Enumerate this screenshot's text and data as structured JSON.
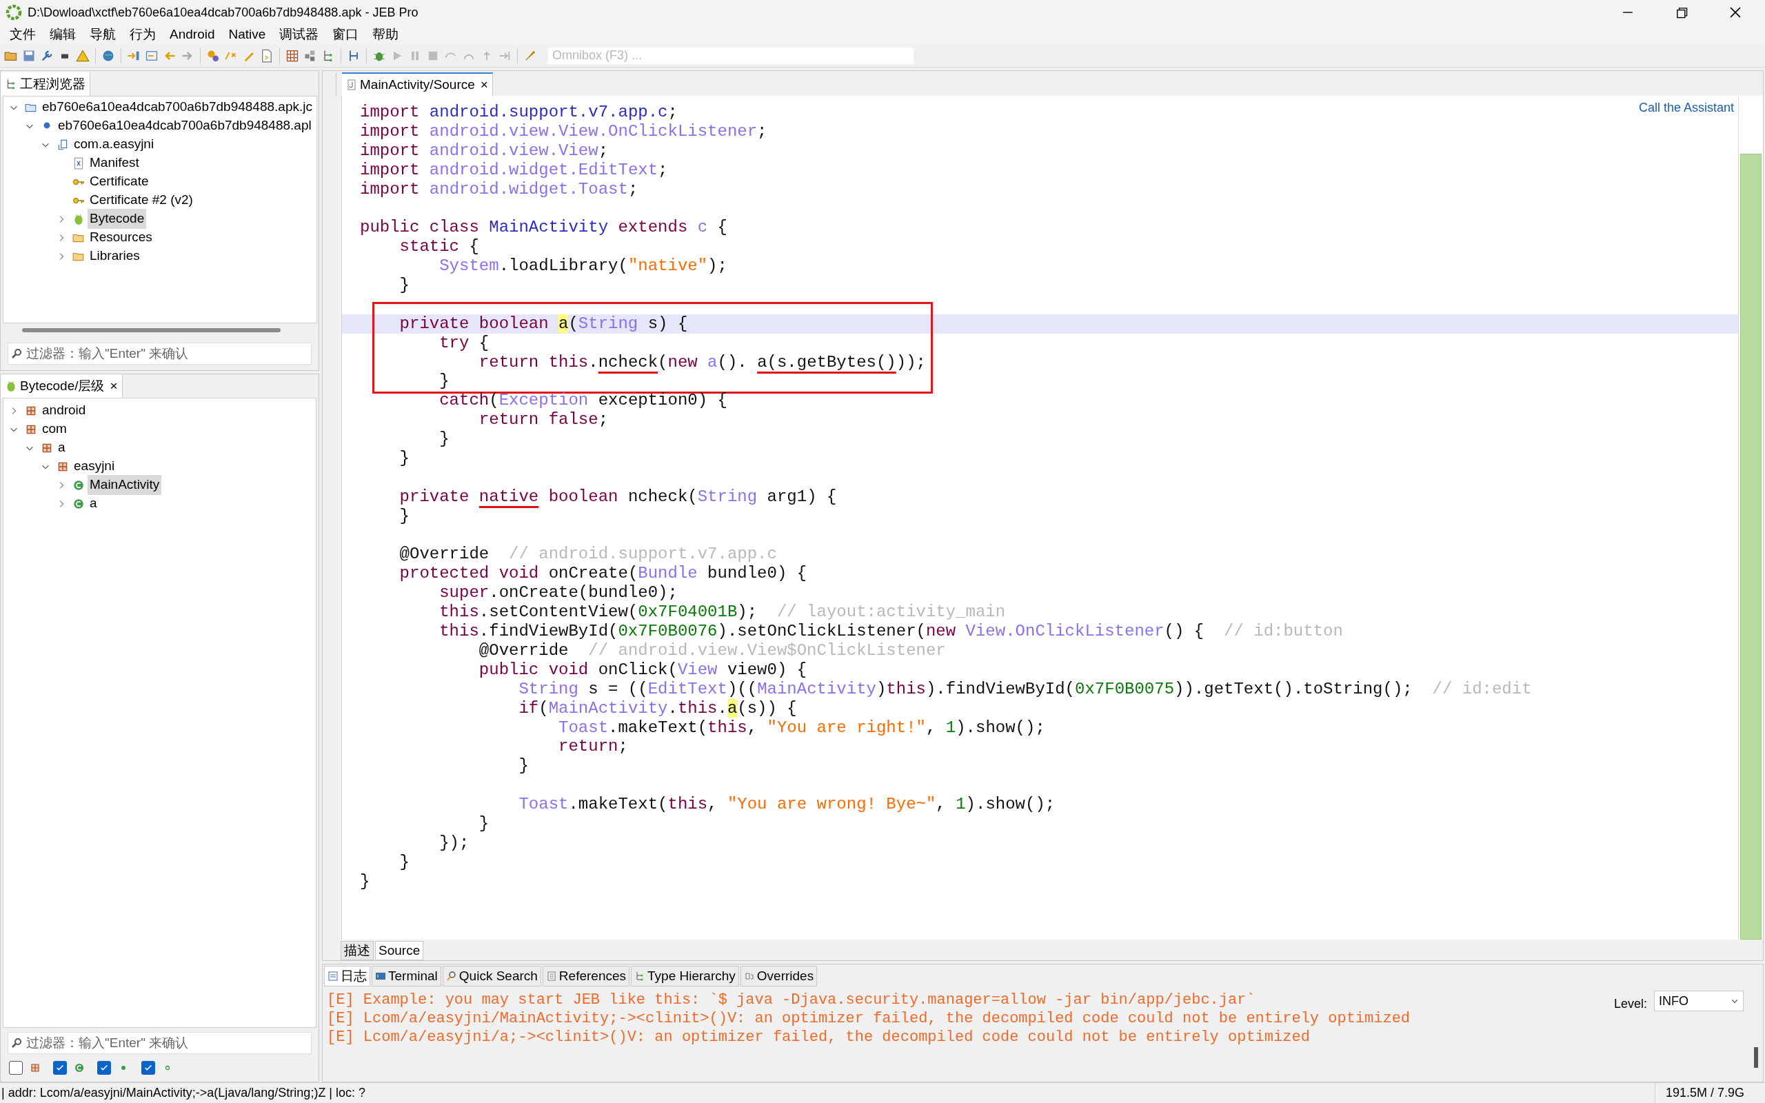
{
  "window": {
    "title": "D:\\Dowload\\xctf\\eb760e6a10ea4dcab700a6b7db948488.apk - JEB Pro"
  },
  "menu": [
    "文件",
    "编辑",
    "导航",
    "行为",
    "Android",
    "Native",
    "调试器",
    "窗口",
    "帮助"
  ],
  "toolbar": {
    "omnibox_placeholder": "Omnibox (F3) ..."
  },
  "project_explorer": {
    "tab": "工程浏览器",
    "filter_placeholder": "过滤器：输入\"Enter\" 来确认",
    "tree": [
      {
        "kind": "project",
        "label": "eb760e6a10ea4dcab700a6b7db948488.apk.jc",
        "expanded": true,
        "selected": false,
        "children": [
          {
            "kind": "apk",
            "label": "eb760e6a10ea4dcab700a6b7db948488.apl",
            "expanded": true,
            "selected": false,
            "children": [
              {
                "kind": "app",
                "label": "com.a.easyjni",
                "expanded": true,
                "selected": false,
                "children": [
                  {
                    "kind": "manifest",
                    "label": "Manifest",
                    "selected": false
                  },
                  {
                    "kind": "certificate",
                    "label": "Certificate",
                    "selected": false
                  },
                  {
                    "kind": "certificate",
                    "label": "Certificate #2 (v2)",
                    "selected": false
                  },
                  {
                    "kind": "bytecode",
                    "label": "Bytecode",
                    "expanded": false,
                    "selected": true
                  },
                  {
                    "kind": "folder",
                    "label": "Resources",
                    "expanded": false,
                    "selected": false
                  },
                  {
                    "kind": "folder",
                    "label": "Libraries",
                    "expanded": false,
                    "selected": false
                  }
                ]
              }
            ]
          }
        ]
      }
    ]
  },
  "hierarchy": {
    "tab": "Bytecode/层级",
    "close": "×",
    "filter_placeholder": "过滤器：输入\"Enter\" 来确认",
    "tree": [
      {
        "kind": "package",
        "label": "android",
        "expanded": false,
        "selected": false
      },
      {
        "kind": "package",
        "label": "com",
        "expanded": true,
        "selected": false,
        "children": [
          {
            "kind": "package",
            "label": "a",
            "expanded": true,
            "selected": false,
            "children": [
              {
                "kind": "package",
                "label": "easyjni",
                "expanded": true,
                "selected": false,
                "children": [
                  {
                    "kind": "class",
                    "label": "MainActivity",
                    "expanded": false,
                    "selected": true
                  },
                  {
                    "kind": "class",
                    "label": "a",
                    "expanded": false,
                    "selected": false
                  }
                ]
              }
            ]
          }
        ]
      }
    ],
    "filters": [
      {
        "kind": "package",
        "checked": false
      },
      {
        "kind": "class",
        "checked": true
      },
      {
        "kind": "method",
        "checked": true
      },
      {
        "kind": "field",
        "checked": true
      }
    ]
  },
  "editor": {
    "tab": "MainActivity/Source",
    "close": "×",
    "assistant_link": "Call the Assistant",
    "blocks": [
      {
        "boxed": false,
        "lines": [
          {
            "current": false,
            "segments": [
              {
                "kind": "kw",
                "text": "import "
              },
              {
                "kind": "pkg",
                "text": "android.support.v7.app.c"
              },
              {
                "kind": "plain",
                "text": ";"
              }
            ]
          },
          {
            "current": false,
            "segments": [
              {
                "kind": "kw",
                "text": "import "
              },
              {
                "kind": "type",
                "text": "android.view.View.OnClickListener"
              },
              {
                "kind": "plain",
                "text": ";"
              }
            ]
          },
          {
            "current": false,
            "segments": [
              {
                "kind": "kw",
                "text": "import "
              },
              {
                "kind": "type",
                "text": "android.view.View"
              },
              {
                "kind": "plain",
                "text": ";"
              }
            ]
          },
          {
            "current": false,
            "segments": [
              {
                "kind": "kw",
                "text": "import "
              },
              {
                "kind": "type",
                "text": "android.widget.EditText"
              },
              {
                "kind": "plain",
                "text": ";"
              }
            ]
          },
          {
            "current": false,
            "segments": [
              {
                "kind": "kw",
                "text": "import "
              },
              {
                "kind": "type",
                "text": "android.widget.Toast"
              },
              {
                "kind": "plain",
                "text": ";"
              }
            ]
          },
          {
            "current": false
          },
          {
            "current": false,
            "segments": [
              {
                "kind": "kw",
                "text": "public class "
              },
              {
                "kind": "pkg",
                "text": "MainActivity"
              },
              {
                "kind": "kw",
                "text": " extends "
              },
              {
                "kind": "type",
                "text": "c"
              },
              {
                "kind": "plain",
                "text": " {"
              }
            ]
          },
          {
            "current": false,
            "segments": [
              {
                "kind": "kw",
                "text": "    static "
              },
              {
                "kind": "plain",
                "text": "{"
              }
            ]
          },
          {
            "current": false,
            "segments": [
              {
                "kind": "type",
                "text": "        System"
              },
              {
                "kind": "plain",
                "text": ".loadLibrary("
              },
              {
                "kind": "str",
                "text": "\"native\""
              },
              {
                "kind": "plain",
                "text": ");"
              }
            ]
          },
          {
            "current": false,
            "segments": [
              {
                "kind": "plain",
                "text": "    }"
              }
            ]
          },
          {
            "current": false
          }
        ]
      },
      {
        "boxed": true,
        "lines": [
          {
            "current": true,
            "segments": [
              {
                "kind": "kw",
                "text": "    private boolean "
              },
              {
                "kind": "plain",
                "text": "a",
                "highlighted": true
              },
              {
                "kind": "plain",
                "text": "("
              },
              {
                "kind": "type",
                "text": "String"
              },
              {
                "kind": "plain",
                "text": " s) {"
              }
            ]
          },
          {
            "current": false,
            "segments": [
              {
                "kind": "kw",
                "text": "        try "
              },
              {
                "kind": "plain",
                "text": "{"
              }
            ]
          },
          {
            "current": false,
            "segments": [
              {
                "kind": "kw",
                "text": "            return this"
              },
              {
                "kind": "plain",
                "text": "."
              },
              {
                "kind": "plain",
                "text": "ncheck",
                "underlined": true
              },
              {
                "kind": "plain",
                "text": "("
              },
              {
                "kind": "kw",
                "text": "new "
              },
              {
                "kind": "type",
                "text": "a"
              },
              {
                "kind": "plain",
                "text": "(). "
              },
              {
                "kind": "plain",
                "text": "a(s.getBytes()",
                "underlined": true
              },
              {
                "kind": "plain",
                "text": "));"
              }
            ]
          },
          {
            "current": false,
            "segments": [
              {
                "kind": "plain",
                "text": "        }"
              }
            ]
          }
        ]
      },
      {
        "boxed": false,
        "lines": [
          {
            "current": false,
            "segments": [
              {
                "kind": "kw",
                "text": "        catch"
              },
              {
                "kind": "plain",
                "text": "("
              },
              {
                "kind": "type",
                "text": "Exception"
              },
              {
                "kind": "plain",
                "text": " exception0) {"
              }
            ]
          },
          {
            "current": false,
            "segments": [
              {
                "kind": "kw",
                "text": "            return false"
              },
              {
                "kind": "plain",
                "text": ";"
              }
            ]
          },
          {
            "current": false,
            "segments": [
              {
                "kind": "plain",
                "text": "        }"
              }
            ]
          },
          {
            "current": false,
            "segments": [
              {
                "kind": "plain",
                "text": "    }"
              }
            ]
          },
          {
            "current": false
          },
          {
            "current": false,
            "segments": [
              {
                "kind": "kw",
                "text": "    private "
              },
              {
                "kind": "kw",
                "text": "native",
                "underlined": true
              },
              {
                "kind": "kw",
                "text": " boolean "
              },
              {
                "kind": "plain",
                "text": "ncheck("
              },
              {
                "kind": "type",
                "text": "String"
              },
              {
                "kind": "plain",
                "text": " arg1) {"
              }
            ]
          },
          {
            "current": false,
            "segments": [
              {
                "kind": "plain",
                "text": "    }"
              }
            ]
          },
          {
            "current": false
          },
          {
            "current": false,
            "segments": [
              {
                "kind": "plain",
                "text": "    @Override  "
              },
              {
                "kind": "cmt",
                "text": "// android.support.v7.app.c"
              }
            ]
          },
          {
            "current": false,
            "segments": [
              {
                "kind": "kw",
                "text": "    protected void "
              },
              {
                "kind": "plain",
                "text": "onCreate("
              },
              {
                "kind": "type",
                "text": "Bundle"
              },
              {
                "kind": "plain",
                "text": " bundle0) {"
              }
            ]
          },
          {
            "current": false,
            "segments": [
              {
                "kind": "kw",
                "text": "        super"
              },
              {
                "kind": "plain",
                "text": ".onCreate(bundle0);"
              }
            ]
          },
          {
            "current": false,
            "segments": [
              {
                "kind": "kw",
                "text": "        this"
              },
              {
                "kind": "plain",
                "text": ".setContentView("
              },
              {
                "kind": "num",
                "text": "0x7F04001B"
              },
              {
                "kind": "plain",
                "text": ");  "
              },
              {
                "kind": "cmt",
                "text": "// layout:activity_main"
              }
            ]
          },
          {
            "current": false,
            "segments": [
              {
                "kind": "kw",
                "text": "        this"
              },
              {
                "kind": "plain",
                "text": ".findViewById("
              },
              {
                "kind": "num",
                "text": "0x7F0B0076"
              },
              {
                "kind": "plain",
                "text": ").setOnClickListener("
              },
              {
                "kind": "kw",
                "text": "new "
              },
              {
                "kind": "type",
                "text": "View.OnClickListener"
              },
              {
                "kind": "plain",
                "text": "() {  "
              },
              {
                "kind": "cmt",
                "text": "// id:button"
              }
            ]
          },
          {
            "current": false,
            "segments": [
              {
                "kind": "plain",
                "text": "            @Override  "
              },
              {
                "kind": "cmt",
                "text": "// android.view.View$OnClickListener"
              }
            ]
          },
          {
            "current": false,
            "segments": [
              {
                "kind": "kw",
                "text": "            public void "
              },
              {
                "kind": "plain",
                "text": "onClick("
              },
              {
                "kind": "type",
                "text": "View"
              },
              {
                "kind": "plain",
                "text": " view0) {"
              }
            ]
          },
          {
            "current": false,
            "segments": [
              {
                "kind": "type",
                "text": "                String"
              },
              {
                "kind": "plain",
                "text": " s = (("
              },
              {
                "kind": "type",
                "text": "EditText"
              },
              {
                "kind": "plain",
                "text": ")(("
              },
              {
                "kind": "type",
                "text": "MainActivity"
              },
              {
                "kind": "plain",
                "text": ")"
              },
              {
                "kind": "kw",
                "text": "this"
              },
              {
                "kind": "plain",
                "text": ").findViewById("
              },
              {
                "kind": "num",
                "text": "0x7F0B0075"
              },
              {
                "kind": "plain",
                "text": ")).getText().toString();  "
              },
              {
                "kind": "cmt",
                "text": "// id:edit"
              }
            ]
          },
          {
            "current": false,
            "segments": [
              {
                "kind": "kw",
                "text": "                if"
              },
              {
                "kind": "plain",
                "text": "("
              },
              {
                "kind": "type",
                "text": "MainActivity"
              },
              {
                "kind": "plain",
                "text": "."
              },
              {
                "kind": "kw",
                "text": "this"
              },
              {
                "kind": "plain",
                "text": "."
              },
              {
                "kind": "plain",
                "text": "a",
                "highlighted": true
              },
              {
                "kind": "plain",
                "text": "(s)) {"
              }
            ]
          },
          {
            "current": false,
            "segments": [
              {
                "kind": "type",
                "text": "                    Toast"
              },
              {
                "kind": "plain",
                "text": ".makeText("
              },
              {
                "kind": "kw",
                "text": "this"
              },
              {
                "kind": "plain",
                "text": ", "
              },
              {
                "kind": "str",
                "text": "\"You are right!\""
              },
              {
                "kind": "plain",
                "text": ", "
              },
              {
                "kind": "num",
                "text": "1"
              },
              {
                "kind": "plain",
                "text": ").show();"
              }
            ]
          },
          {
            "current": false,
            "segments": [
              {
                "kind": "kw",
                "text": "                    return"
              },
              {
                "kind": "plain",
                "text": ";"
              }
            ]
          },
          {
            "current": false,
            "segments": [
              {
                "kind": "plain",
                "text": "                }"
              }
            ]
          },
          {
            "current": false
          },
          {
            "current": false,
            "segments": [
              {
                "kind": "type",
                "text": "                Toast"
              },
              {
                "kind": "plain",
                "text": ".makeText("
              },
              {
                "kind": "kw",
                "text": "this"
              },
              {
                "kind": "plain",
                "text": ", "
              },
              {
                "kind": "str",
                "text": "\"You are wrong! Bye~\""
              },
              {
                "kind": "plain",
                "text": ", "
              },
              {
                "kind": "num",
                "text": "1"
              },
              {
                "kind": "plain",
                "text": ").show();"
              }
            ]
          },
          {
            "current": false,
            "segments": [
              {
                "kind": "plain",
                "text": "            }"
              }
            ]
          },
          {
            "current": false,
            "segments": [
              {
                "kind": "plain",
                "text": "        });"
              }
            ]
          },
          {
            "current": false,
            "segments": [
              {
                "kind": "plain",
                "text": "    }"
              }
            ]
          },
          {
            "current": false,
            "segments": [
              {
                "kind": "plain",
                "text": "}"
              }
            ]
          }
        ]
      }
    ],
    "subtabs": [
      {
        "label": "描述",
        "selected": false
      },
      {
        "label": "Source",
        "selected": true
      }
    ]
  },
  "bottom_panel": {
    "tabs": [
      {
        "label": "日志",
        "selected": true
      },
      {
        "label": "Terminal",
        "selected": false
      },
      {
        "label": "Quick Search",
        "selected": false
      },
      {
        "label": "References",
        "selected": false
      },
      {
        "label": "Type Hierarchy",
        "selected": false
      },
      {
        "label": "Overrides",
        "selected": false
      }
    ],
    "log": [
      "[E] Example: you may start JEB like this: `$ java -Djava.security.manager=allow -jar bin/app/jebc.jar`",
      "[E] Lcom/a/easyjni/MainActivity;-><clinit>()V: an optimizer failed, the decompiled code could not be entirely optimized",
      "[E] Lcom/a/easyjni/a;-><clinit>()V: an optimizer failed, the decompiled code could not be entirely optimized"
    ],
    "level_label": "Level:",
    "level_value": "INFO"
  },
  "status_bar": {
    "address": "| addr: Lcom/a/easyjni/MainActivity;->a(Ljava/lang/String;)Z | loc: ?",
    "memory": "191.5M / 7.9G"
  }
}
